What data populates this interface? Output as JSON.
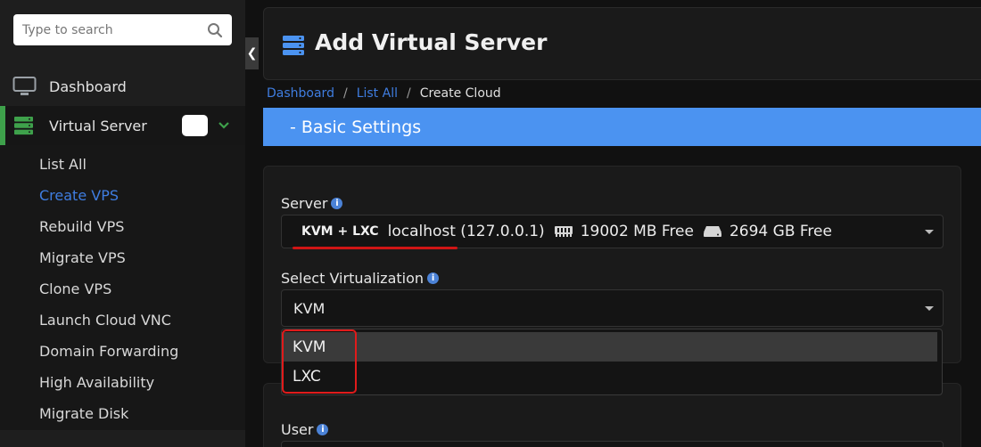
{
  "search": {
    "placeholder": "Type to search"
  },
  "sidebar": {
    "items": [
      {
        "label": "Dashboard",
        "icon": "monitor-icon"
      },
      {
        "label": "Virtual Server",
        "icon": "server-icon"
      }
    ],
    "submenu": [
      "List All",
      "Create VPS",
      "Rebuild VPS",
      "Migrate VPS",
      "Clone VPS",
      "Launch Cloud VNC",
      "Domain Forwarding",
      "High Availability",
      "Migrate Disk"
    ],
    "active_sub": "Create VPS",
    "accent_color": "#3ea14b",
    "link_color": "#3f7de0"
  },
  "header": {
    "title": "Add Virtual Server",
    "icon": "server-stack-icon"
  },
  "breadcrumb": {
    "items": [
      "Dashboard",
      "List All"
    ],
    "current": "Create Cloud"
  },
  "section": {
    "title": "-  Basic Settings",
    "color": "#4b93f1"
  },
  "form": {
    "server_label": "Server",
    "server": {
      "type_tag": "KVM + LXC",
      "host": "localhost (127.0.0.1)",
      "ram": "19002 MB Free",
      "disk": "2694 GB Free"
    },
    "virt_label": "Select Virtualization",
    "virt_value": "KVM",
    "virt_options": [
      "KVM",
      "LXC"
    ],
    "user_label": "User"
  }
}
